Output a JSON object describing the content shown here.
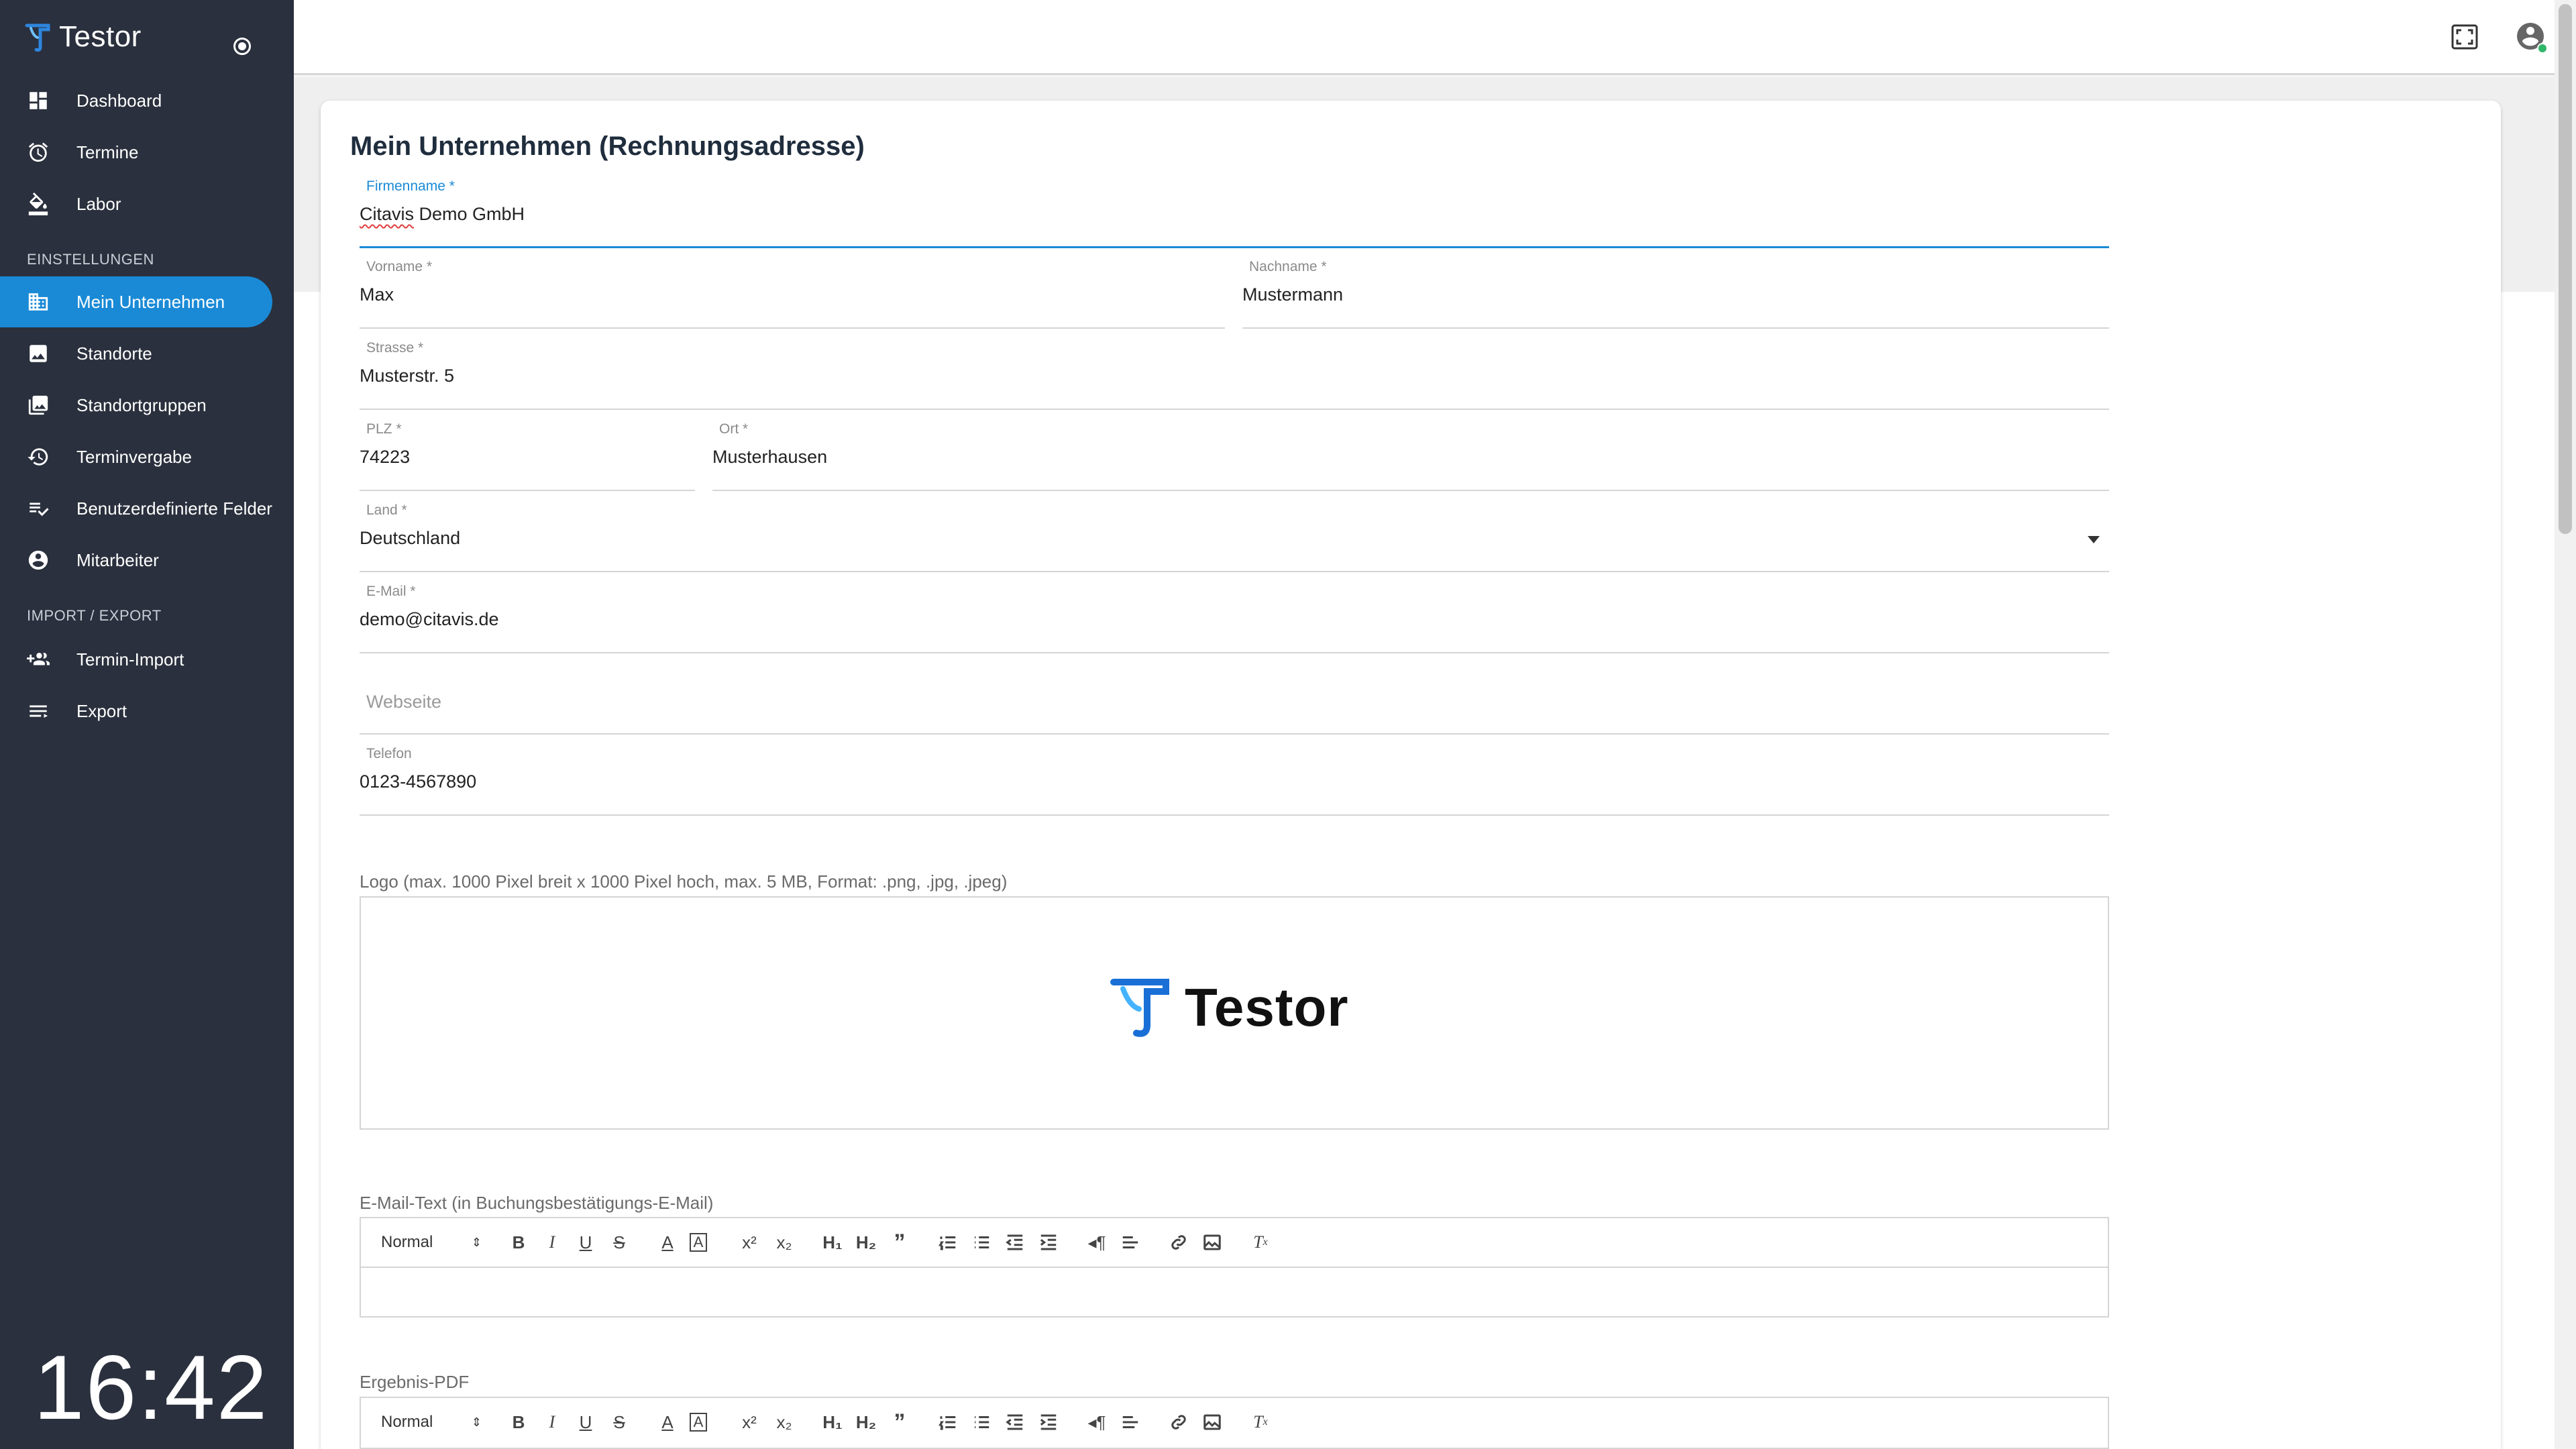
{
  "app": {
    "name": "Testor"
  },
  "sidebar": {
    "items_top": [
      {
        "label": "Dashboard",
        "icon": "dashboard-icon"
      },
      {
        "label": "Termine",
        "icon": "alarm-clock-icon"
      },
      {
        "label": "Labor",
        "icon": "paint-bucket-icon"
      }
    ],
    "section_settings": "EINSTELLUNGEN",
    "items_settings": [
      {
        "label": "Mein Unternehmen",
        "icon": "building-icon",
        "active": true
      },
      {
        "label": "Standorte",
        "icon": "image-icon"
      },
      {
        "label": "Standortgruppen",
        "icon": "image-stack-icon"
      },
      {
        "label": "Terminvergabe",
        "icon": "history-icon"
      },
      {
        "label": "Benutzerdefinierte Felder",
        "icon": "checklist-icon"
      },
      {
        "label": "Mitarbeiter",
        "icon": "account-circle-icon"
      }
    ],
    "section_import": "IMPORT / EXPORT",
    "items_import": [
      {
        "label": "Termin-Import",
        "icon": "group-add-icon"
      },
      {
        "label": "Export",
        "icon": "list-icon"
      }
    ],
    "clock": "16:42"
  },
  "form": {
    "title": "Mein Unternehmen (Rechnungsadresse)",
    "firmenname": {
      "label": "Firmenname *",
      "value_part1": "Citavis",
      "value_part2": " Demo GmbH"
    },
    "vorname": {
      "label": "Vorname *",
      "value": "Max"
    },
    "nachname": {
      "label": "Nachname *",
      "value": "Mustermann"
    },
    "strasse": {
      "label": "Strasse *",
      "value": "Musterstr. 5"
    },
    "plz": {
      "label": "PLZ *",
      "value": "74223"
    },
    "ort": {
      "label": "Ort *",
      "value": "Musterhausen"
    },
    "land": {
      "label": "Land *",
      "value": "Deutschland"
    },
    "email": {
      "label": "E-Mail *",
      "value": "demo@citavis.de"
    },
    "webseite": {
      "placeholder": "Webseite"
    },
    "telefon": {
      "label": "Telefon",
      "value": "0123-4567890"
    },
    "logo_label": "Logo (max. 1000 Pixel breit x 1000 Pixel hoch, max. 5 MB, Format: .png, .jpg, .jpeg)",
    "logo_text": "Testor",
    "email_text_label": "E-Mail-Text (in Buchungsbestätigungs-E-Mail)",
    "ergebnis_pdf_label": "Ergebnis-PDF",
    "editor_format": "Normal"
  },
  "colors": {
    "sidebar_bg": "#2a303d",
    "accent": "#1a8ad6",
    "status_online": "#2fb66a"
  }
}
